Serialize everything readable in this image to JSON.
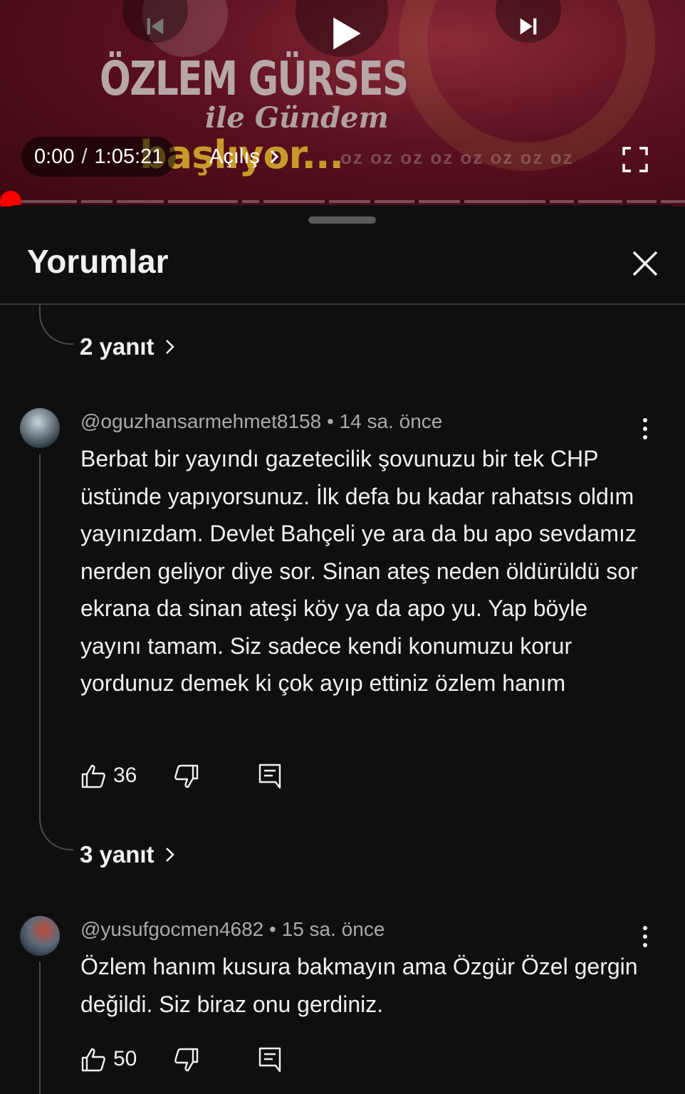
{
  "player": {
    "show_title": "ÖZLEM GÜRSES",
    "show_subtitle": "ile Gündem",
    "show_status": "başlıyor...",
    "watermark": "oz oz oz oz oz oz oz oz",
    "current_time": "0:00",
    "time_separator": "/",
    "duration": "1:05:21",
    "chapter_label": "Açılış",
    "progress": 0.0,
    "accent_color": "#ff0000"
  },
  "comments_panel": {
    "title": "Yorumlar",
    "threads": [
      {
        "replies_label": "2 yanıt"
      },
      {
        "author": "@oguzhansarmehmet8158",
        "meta_sep": "•",
        "time": "14 sa. önce",
        "body": "Berbat bir yayındı gazetecilik şovunuzu bir tek CHP üstünde yapıyorsunuz. İlk defa bu kadar rahatsıs oldım yayınızdam. Devlet Bahçeli ye ara da bu apo sevdamız nerden geliyor diye sor. Sinan ateş neden öldürüldü sor ekrana da sinan ateşi köy ya da apo yu. Yap böyle yayını tamam. Siz sadece kendi konumuzu korur yordunuz demek ki çok ayıp ettiniz özlem hanım",
        "likes": "36",
        "replies_label": "3 yanıt"
      },
      {
        "author": "@yusufgocmen4682",
        "meta_sep": "•",
        "time": "15 sa. önce",
        "body": "Özlem hanım kusura bakmayın ama Özgür Özel gergin değildi. Siz biraz onu gerdiniz.",
        "likes": "50"
      }
    ]
  },
  "icons": {
    "previous": "skip-previous-icon",
    "play": "play-icon",
    "next": "skip-next-icon",
    "chapter_arrow": "chevron-right-icon",
    "fullscreen": "fullscreen-icon",
    "close": "close-icon",
    "more": "more-vert-icon",
    "like": "thumb-up-icon",
    "dislike": "thumb-down-icon",
    "reply": "comment-reply-icon"
  }
}
